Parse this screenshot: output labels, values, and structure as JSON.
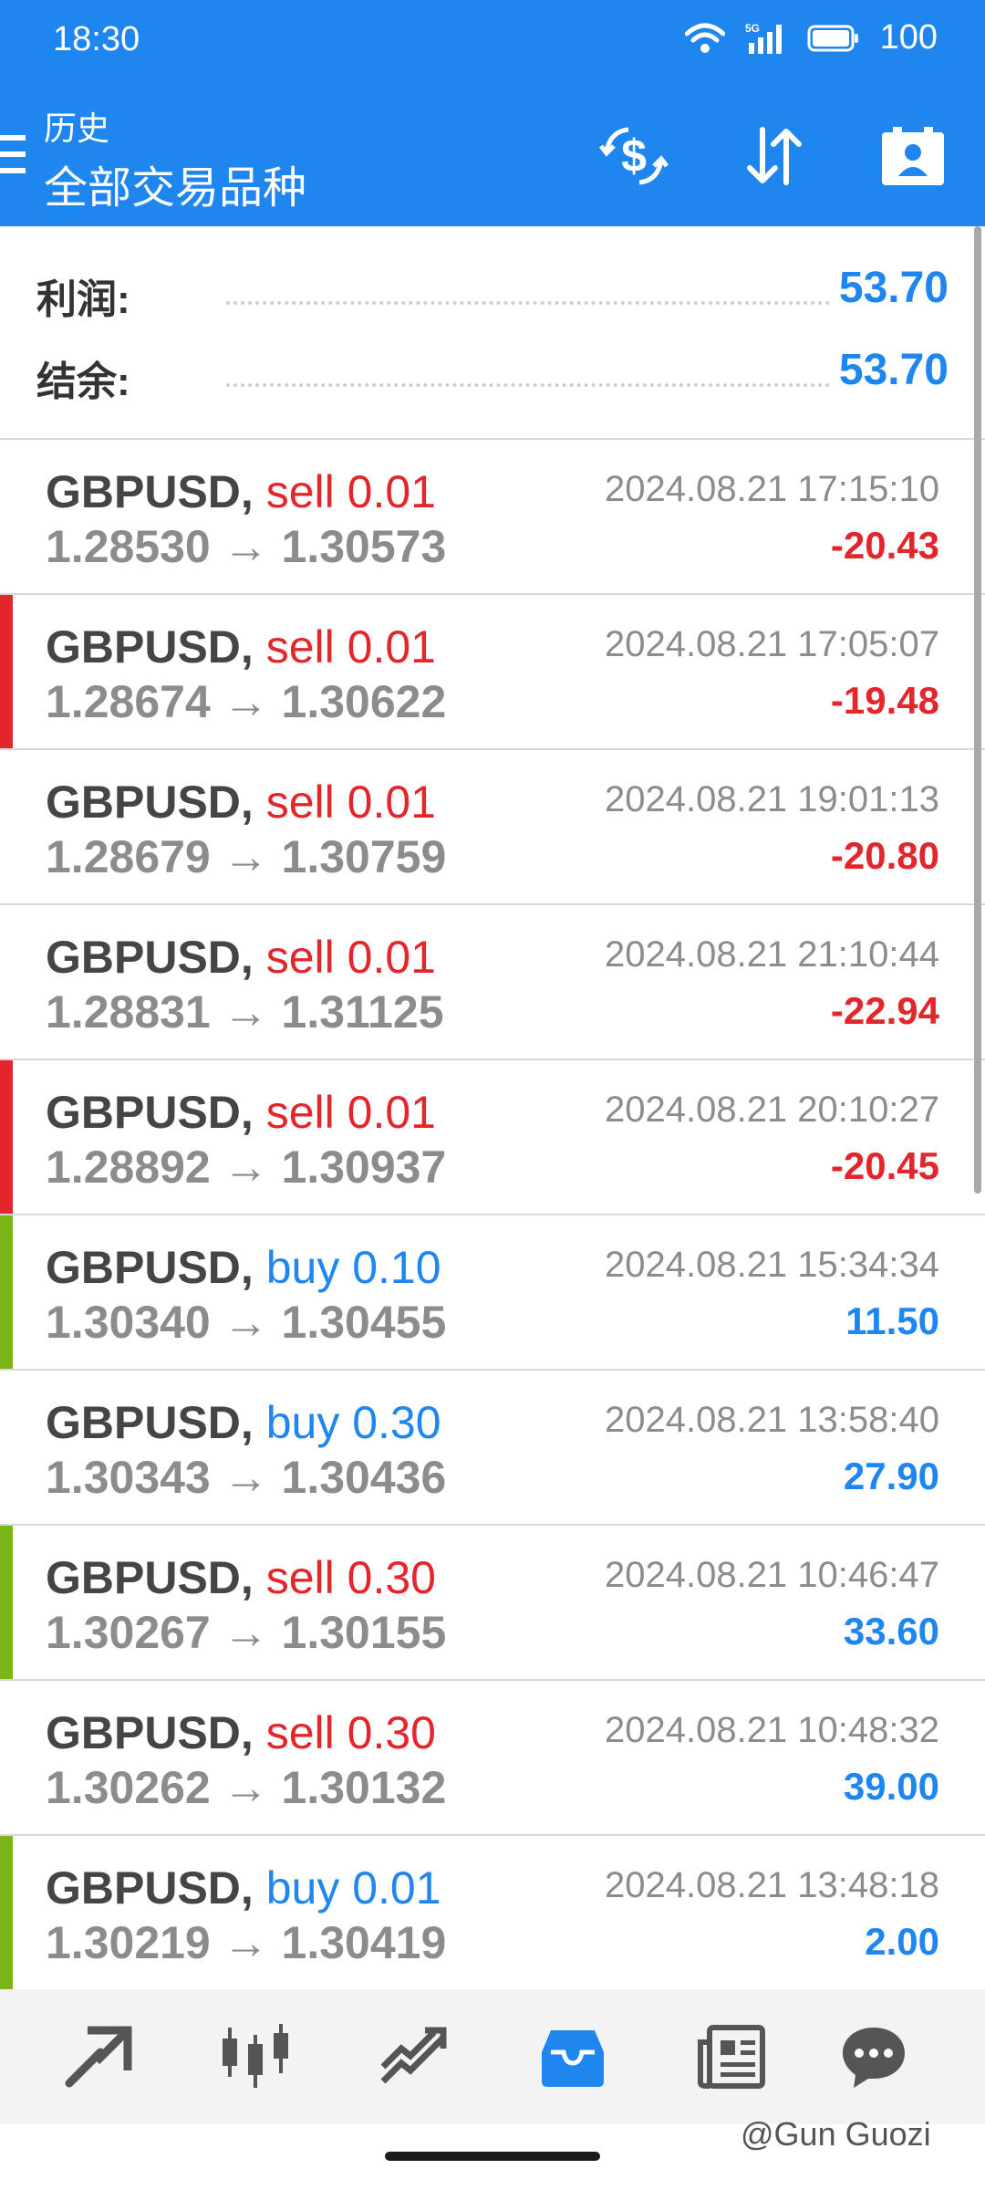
{
  "status_bar": {
    "time": "18:30",
    "battery": "100",
    "network": "5G"
  },
  "header": {
    "title_small": "历史",
    "title_large": "全部交易品种",
    "actions": [
      "currency-exchange-icon",
      "sort-icon",
      "account-badge-icon"
    ]
  },
  "summary": {
    "profit_label": "利润:",
    "profit_value": "53.70",
    "balance_label": "结余:",
    "balance_value": "53.70"
  },
  "trades": [
    {
      "symbol": "GBPUSD,",
      "side": "sell 0.01",
      "prices": "1.28530 → 1.30573",
      "time": "2024.08.21 17:15:10",
      "profit": "-20.43",
      "accent": "none"
    },
    {
      "symbol": "GBPUSD,",
      "side": "sell 0.01",
      "prices": "1.28674 → 1.30622",
      "time": "2024.08.21 17:05:07",
      "profit": "-19.48",
      "accent": "red"
    },
    {
      "symbol": "GBPUSD,",
      "side": "sell 0.01",
      "prices": "1.28679 → 1.30759",
      "time": "2024.08.21 19:01:13",
      "profit": "-20.80",
      "accent": "none"
    },
    {
      "symbol": "GBPUSD,",
      "side": "sell 0.01",
      "prices": "1.28831 → 1.31125",
      "time": "2024.08.21 21:10:44",
      "profit": "-22.94",
      "accent": "none"
    },
    {
      "symbol": "GBPUSD,",
      "side": "sell 0.01",
      "prices": "1.28892 → 1.30937",
      "time": "2024.08.21 20:10:27",
      "profit": "-20.45",
      "accent": "red"
    },
    {
      "symbol": "GBPUSD,",
      "side": "buy 0.10",
      "prices": "1.30340 → 1.30455",
      "time": "2024.08.21 15:34:34",
      "profit": "11.50",
      "accent": "green"
    },
    {
      "symbol": "GBPUSD,",
      "side": "buy 0.30",
      "prices": "1.30343 → 1.30436",
      "time": "2024.08.21 13:58:40",
      "profit": "27.90",
      "accent": "none"
    },
    {
      "symbol": "GBPUSD,",
      "side": "sell 0.30",
      "prices": "1.30267 → 1.30155",
      "time": "2024.08.21 10:46:47",
      "profit": "33.60",
      "accent": "green"
    },
    {
      "symbol": "GBPUSD,",
      "side": "sell 0.30",
      "prices": "1.30262 → 1.30132",
      "time": "2024.08.21 10:48:32",
      "profit": "39.00",
      "accent": "none"
    },
    {
      "symbol": "GBPUSD,",
      "side": "buy 0.01",
      "prices": "1.30219 → 1.30419",
      "time": "2024.08.21 13:48:18",
      "profit": "2.00",
      "accent": "green"
    }
  ],
  "bottom_nav": [
    "quotes-icon",
    "chart-icon",
    "trade-icon",
    "history-icon",
    "news-icon",
    "chat-icon"
  ],
  "watermark": "@Gun Guozi",
  "colors": {
    "header_bg": "#1f86f0",
    "sell": "#e3262b",
    "buy": "#1f86f0",
    "loss": "#e3262b",
    "gain": "#1f86f0",
    "accent_red": "#e3262b",
    "accent_green": "#7cb518"
  }
}
